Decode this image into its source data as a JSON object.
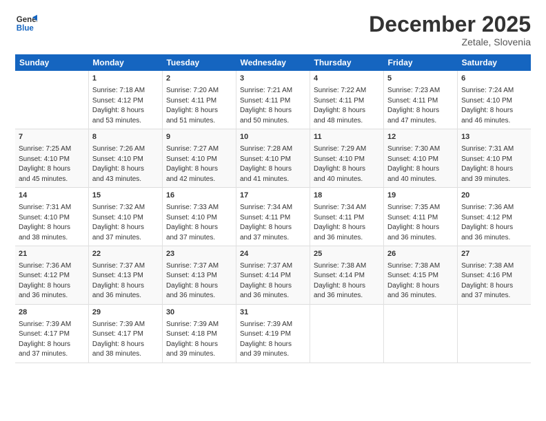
{
  "header": {
    "logo_line1": "General",
    "logo_line2": "Blue",
    "title": "December 2025",
    "subtitle": "Zetale, Slovenia"
  },
  "columns": [
    "Sunday",
    "Monday",
    "Tuesday",
    "Wednesday",
    "Thursday",
    "Friday",
    "Saturday"
  ],
  "weeks": [
    {
      "days": [
        {
          "num": "",
          "lines": []
        },
        {
          "num": "1",
          "lines": [
            "Sunrise: 7:18 AM",
            "Sunset: 4:12 PM",
            "Daylight: 8 hours",
            "and 53 minutes."
          ]
        },
        {
          "num": "2",
          "lines": [
            "Sunrise: 7:20 AM",
            "Sunset: 4:11 PM",
            "Daylight: 8 hours",
            "and 51 minutes."
          ]
        },
        {
          "num": "3",
          "lines": [
            "Sunrise: 7:21 AM",
            "Sunset: 4:11 PM",
            "Daylight: 8 hours",
            "and 50 minutes."
          ]
        },
        {
          "num": "4",
          "lines": [
            "Sunrise: 7:22 AM",
            "Sunset: 4:11 PM",
            "Daylight: 8 hours",
            "and 48 minutes."
          ]
        },
        {
          "num": "5",
          "lines": [
            "Sunrise: 7:23 AM",
            "Sunset: 4:11 PM",
            "Daylight: 8 hours",
            "and 47 minutes."
          ]
        },
        {
          "num": "6",
          "lines": [
            "Sunrise: 7:24 AM",
            "Sunset: 4:10 PM",
            "Daylight: 8 hours",
            "and 46 minutes."
          ]
        }
      ]
    },
    {
      "days": [
        {
          "num": "7",
          "lines": [
            "Sunrise: 7:25 AM",
            "Sunset: 4:10 PM",
            "Daylight: 8 hours",
            "and 45 minutes."
          ]
        },
        {
          "num": "8",
          "lines": [
            "Sunrise: 7:26 AM",
            "Sunset: 4:10 PM",
            "Daylight: 8 hours",
            "and 43 minutes."
          ]
        },
        {
          "num": "9",
          "lines": [
            "Sunrise: 7:27 AM",
            "Sunset: 4:10 PM",
            "Daylight: 8 hours",
            "and 42 minutes."
          ]
        },
        {
          "num": "10",
          "lines": [
            "Sunrise: 7:28 AM",
            "Sunset: 4:10 PM",
            "Daylight: 8 hours",
            "and 41 minutes."
          ]
        },
        {
          "num": "11",
          "lines": [
            "Sunrise: 7:29 AM",
            "Sunset: 4:10 PM",
            "Daylight: 8 hours",
            "and 40 minutes."
          ]
        },
        {
          "num": "12",
          "lines": [
            "Sunrise: 7:30 AM",
            "Sunset: 4:10 PM",
            "Daylight: 8 hours",
            "and 40 minutes."
          ]
        },
        {
          "num": "13",
          "lines": [
            "Sunrise: 7:31 AM",
            "Sunset: 4:10 PM",
            "Daylight: 8 hours",
            "and 39 minutes."
          ]
        }
      ]
    },
    {
      "days": [
        {
          "num": "14",
          "lines": [
            "Sunrise: 7:31 AM",
            "Sunset: 4:10 PM",
            "Daylight: 8 hours",
            "and 38 minutes."
          ]
        },
        {
          "num": "15",
          "lines": [
            "Sunrise: 7:32 AM",
            "Sunset: 4:10 PM",
            "Daylight: 8 hours",
            "and 37 minutes."
          ]
        },
        {
          "num": "16",
          "lines": [
            "Sunrise: 7:33 AM",
            "Sunset: 4:10 PM",
            "Daylight: 8 hours",
            "and 37 minutes."
          ]
        },
        {
          "num": "17",
          "lines": [
            "Sunrise: 7:34 AM",
            "Sunset: 4:11 PM",
            "Daylight: 8 hours",
            "and 37 minutes."
          ]
        },
        {
          "num": "18",
          "lines": [
            "Sunrise: 7:34 AM",
            "Sunset: 4:11 PM",
            "Daylight: 8 hours",
            "and 36 minutes."
          ]
        },
        {
          "num": "19",
          "lines": [
            "Sunrise: 7:35 AM",
            "Sunset: 4:11 PM",
            "Daylight: 8 hours",
            "and 36 minutes."
          ]
        },
        {
          "num": "20",
          "lines": [
            "Sunrise: 7:36 AM",
            "Sunset: 4:12 PM",
            "Daylight: 8 hours",
            "and 36 minutes."
          ]
        }
      ]
    },
    {
      "days": [
        {
          "num": "21",
          "lines": [
            "Sunrise: 7:36 AM",
            "Sunset: 4:12 PM",
            "Daylight: 8 hours",
            "and 36 minutes."
          ]
        },
        {
          "num": "22",
          "lines": [
            "Sunrise: 7:37 AM",
            "Sunset: 4:13 PM",
            "Daylight: 8 hours",
            "and 36 minutes."
          ]
        },
        {
          "num": "23",
          "lines": [
            "Sunrise: 7:37 AM",
            "Sunset: 4:13 PM",
            "Daylight: 8 hours",
            "and 36 minutes."
          ]
        },
        {
          "num": "24",
          "lines": [
            "Sunrise: 7:37 AM",
            "Sunset: 4:14 PM",
            "Daylight: 8 hours",
            "and 36 minutes."
          ]
        },
        {
          "num": "25",
          "lines": [
            "Sunrise: 7:38 AM",
            "Sunset: 4:14 PM",
            "Daylight: 8 hours",
            "and 36 minutes."
          ]
        },
        {
          "num": "26",
          "lines": [
            "Sunrise: 7:38 AM",
            "Sunset: 4:15 PM",
            "Daylight: 8 hours",
            "and 36 minutes."
          ]
        },
        {
          "num": "27",
          "lines": [
            "Sunrise: 7:38 AM",
            "Sunset: 4:16 PM",
            "Daylight: 8 hours",
            "and 37 minutes."
          ]
        }
      ]
    },
    {
      "days": [
        {
          "num": "28",
          "lines": [
            "Sunrise: 7:39 AM",
            "Sunset: 4:17 PM",
            "Daylight: 8 hours",
            "and 37 minutes."
          ]
        },
        {
          "num": "29",
          "lines": [
            "Sunrise: 7:39 AM",
            "Sunset: 4:17 PM",
            "Daylight: 8 hours",
            "and 38 minutes."
          ]
        },
        {
          "num": "30",
          "lines": [
            "Sunrise: 7:39 AM",
            "Sunset: 4:18 PM",
            "Daylight: 8 hours",
            "and 39 minutes."
          ]
        },
        {
          "num": "31",
          "lines": [
            "Sunrise: 7:39 AM",
            "Sunset: 4:19 PM",
            "Daylight: 8 hours",
            "and 39 minutes."
          ]
        },
        {
          "num": "",
          "lines": []
        },
        {
          "num": "",
          "lines": []
        },
        {
          "num": "",
          "lines": []
        }
      ]
    }
  ]
}
